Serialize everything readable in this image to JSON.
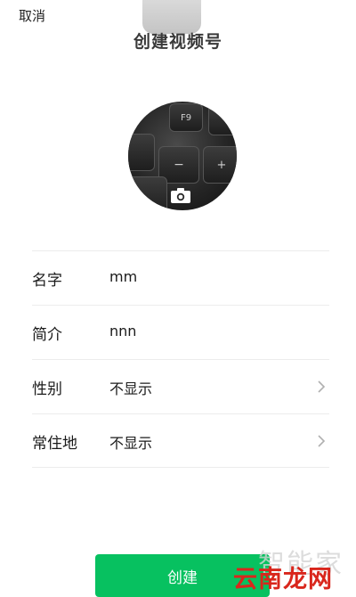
{
  "header": {
    "cancel_label": "取消",
    "title": "创建视频号"
  },
  "avatar": {
    "icon": "camera-icon",
    "keys": [
      "F9",
      "−",
      "+"
    ]
  },
  "form": {
    "rows": [
      {
        "label": "名字",
        "value": "mm",
        "chevron": false
      },
      {
        "label": "简介",
        "value": "nnn",
        "chevron": false
      },
      {
        "label": "性别",
        "value": "不显示",
        "chevron": true
      },
      {
        "label": "常住地",
        "value": "不显示",
        "chevron": true
      }
    ]
  },
  "actions": {
    "create_label": "创建"
  },
  "watermark": {
    "line1": "智能家",
    "line2": "云南龙网"
  },
  "colors": {
    "accent": "#07c160",
    "watermark_red": "#d9261c"
  }
}
